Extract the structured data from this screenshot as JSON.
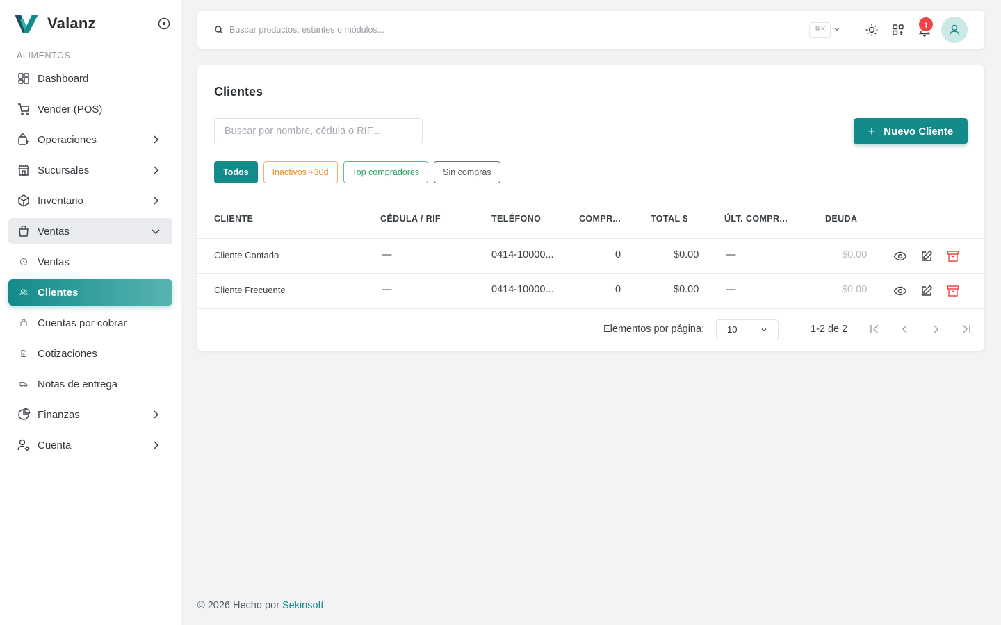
{
  "brand": {
    "name": "Valanz"
  },
  "sidebar": {
    "section": "ALIMENTOS",
    "items": [
      {
        "label": "Dashboard"
      },
      {
        "label": "Vender (POS)"
      },
      {
        "label": "Operaciones"
      },
      {
        "label": "Sucursales"
      },
      {
        "label": "Inventario"
      },
      {
        "label": "Ventas"
      },
      {
        "label": "Ventas"
      },
      {
        "label": "Clientes"
      },
      {
        "label": "Cuentas por cobrar"
      },
      {
        "label": "Cotizaciones"
      },
      {
        "label": "Notas de entrega"
      },
      {
        "label": "Finanzas"
      },
      {
        "label": "Cuenta"
      }
    ]
  },
  "topbar": {
    "search_placeholder": "Buscar productos, estantes o módulos...",
    "shortcut": "⌘K",
    "notifications_count": "1"
  },
  "page": {
    "title": "Clientes",
    "search_placeholder": "Buscar por nombre, cédula o RIF...",
    "new_button": "Nuevo Cliente",
    "filters": [
      "Todos",
      "Inactivos +30d",
      "Top compradores",
      "Sin compras"
    ]
  },
  "table": {
    "headers": [
      "CLIENTE",
      "CÉDULA / RIF",
      "TELÉFONO",
      "COMPR...",
      "TOTAL $",
      "ÚLT. COMPR...",
      "DEUDA"
    ],
    "rows": [
      {
        "cliente": "Cliente Contado",
        "cedula": "—",
        "telefono": "0414-10000...",
        "compras": "0",
        "total": "$0.00",
        "ultima": "—",
        "deuda": "$0.00"
      },
      {
        "cliente": "Cliente Frecuente",
        "cedula": "—",
        "telefono": "0414-10000...",
        "compras": "0",
        "total": "$0.00",
        "ultima": "—",
        "deuda": "$0.00"
      }
    ]
  },
  "pagination": {
    "per_page_label": "Elementos por página:",
    "per_page_value": "10",
    "range": "1-2 de 2"
  },
  "footer": {
    "text": "© 2026 Hecho por",
    "link": "Sekinsoft"
  },
  "colors": {
    "accent": "#138b8a",
    "danger": "#ef4444",
    "warning": "#ee8c22",
    "success": "#27a55f"
  }
}
